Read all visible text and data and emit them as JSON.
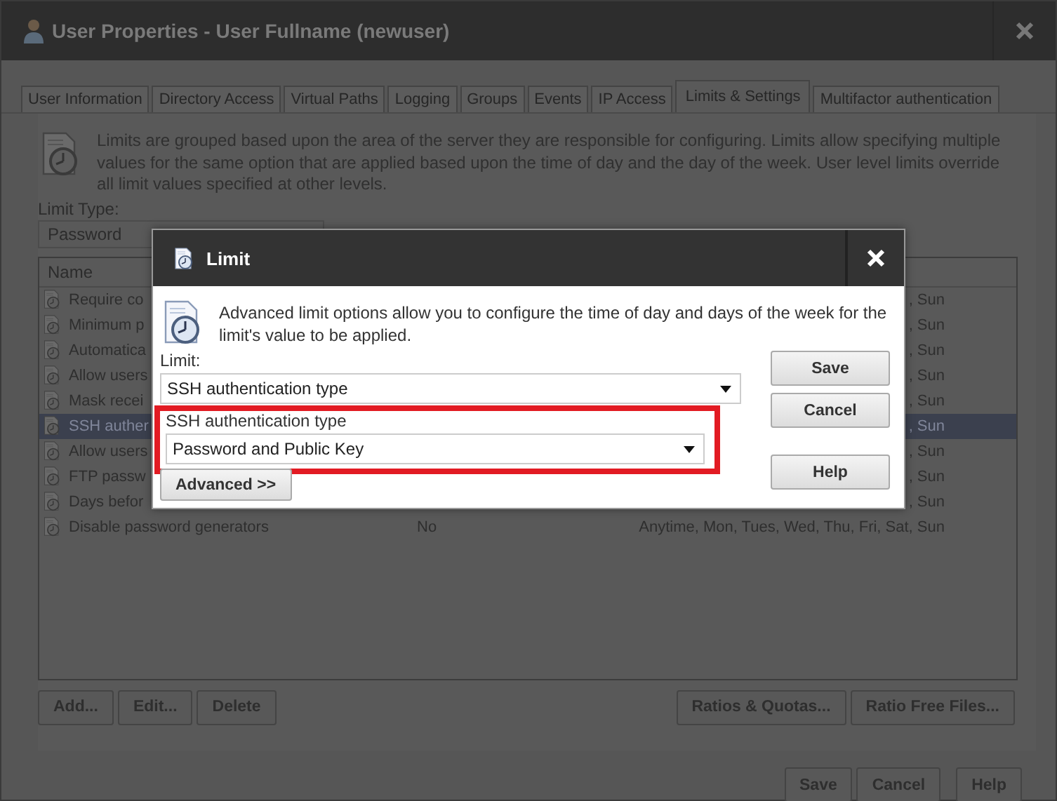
{
  "window": {
    "title": "User Properties - User Fullname (newuser)"
  },
  "tabs": [
    {
      "label": "User Information",
      "selected": false
    },
    {
      "label": "Directory Access",
      "selected": false
    },
    {
      "label": "Virtual Paths",
      "selected": false
    },
    {
      "label": "Logging",
      "selected": false
    },
    {
      "label": "Groups",
      "selected": false
    },
    {
      "label": "Events",
      "selected": false
    },
    {
      "label": "IP Access",
      "selected": false
    },
    {
      "label": "Limits & Settings",
      "selected": true
    },
    {
      "label": "Multifactor authentication",
      "selected": false
    }
  ],
  "limits_panel": {
    "description": "Limits are grouped based upon the area of the server they are responsible for configuring. Limits allow specifying multiple values for the same option that are applied based upon the time of day and the day of the week. User level limits override all limit values specified at other levels.",
    "limit_type_label": "Limit Type:",
    "limit_type": "Password",
    "table": {
      "columns": [
        "Name"
      ],
      "rows": [
        {
          "name": "Require co",
          "schedule": ", Sun",
          "selected": false
        },
        {
          "name": "Minimum p",
          "schedule": ", Sun",
          "selected": false
        },
        {
          "name": "Automatica",
          "schedule": ", Sun",
          "selected": false
        },
        {
          "name": "Allow users",
          "schedule": ", Sun",
          "selected": false
        },
        {
          "name": "Mask recei",
          "schedule": ", Sun",
          "selected": false
        },
        {
          "name": "SSH auther",
          "schedule": ", Sun",
          "selected": true
        },
        {
          "name": "Allow users",
          "schedule": ", Sun",
          "selected": false
        },
        {
          "name": "FTP passw",
          "schedule": ", Sun",
          "selected": false
        },
        {
          "name": "Days befor",
          "schedule": ", Sun",
          "selected": false
        },
        {
          "name": "Disable password generators",
          "value": "No",
          "schedule": "Anytime, Mon, Tues, Wed, Thu, Fri, Sat, Sun",
          "selected": false
        }
      ]
    },
    "buttons_left": [
      "Add...",
      "Edit...",
      "Delete"
    ],
    "buttons_right": [
      "Ratios & Quotas...",
      "Ratio Free Files..."
    ]
  },
  "footer_buttons": [
    "Save",
    "Cancel",
    "Help"
  ],
  "limit_dialog": {
    "title": "Limit",
    "description": "Advanced limit options allow you to configure the time of day and days of the week for the limit's value to be applied.",
    "limit_label": "Limit:",
    "limit_value": "SSH authentication type",
    "option_label": "SSH authentication type",
    "option_value": "Password and Public Key",
    "advanced_button": "Advanced >>",
    "buttons": [
      "Save",
      "Cancel",
      "Help"
    ]
  }
}
